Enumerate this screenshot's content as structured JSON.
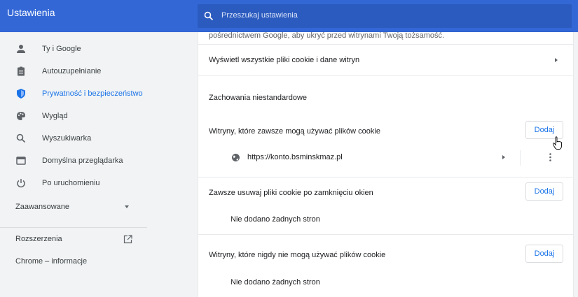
{
  "header": {
    "title": "Ustawienia",
    "search_placeholder": "Przeszukaj ustawienia"
  },
  "sidebar": {
    "items": [
      {
        "label": "Ty i Google",
        "icon": "person-icon",
        "active": false
      },
      {
        "label": "Autouzupełnianie",
        "icon": "clipboard-icon",
        "active": false
      },
      {
        "label": "Prywatność i bezpieczeństwo",
        "icon": "shield-icon",
        "active": true
      },
      {
        "label": "Wygląd",
        "icon": "palette-icon",
        "active": false
      },
      {
        "label": "Wyszukiwarka",
        "icon": "search-icon",
        "active": false
      },
      {
        "label": "Domyślna przeglądarka",
        "icon": "browser-icon",
        "active": false
      },
      {
        "label": "Po uruchomieniu",
        "icon": "power-icon",
        "active": false
      }
    ],
    "advanced_label": "Zaawansowane",
    "extensions_label": "Rozszerzenia",
    "about_label": "Chrome – informacje"
  },
  "content": {
    "truncated_text": "pośrednictwem Google, aby ukryć przed witrynami Twoją tożsamość.",
    "view_all_cookies": "Wyświetl wszystkie pliki cookie i dane witryn",
    "custom_behaviors_heading": "Zachowania niestandardowe",
    "sections": [
      {
        "label": "Witryny, które zawsze mogą używać plików cookie",
        "button": "Dodaj",
        "sites": [
          "https://konto.bsminskmaz.pl"
        ]
      },
      {
        "label": "Zawsze usuwaj pliki cookie po zamknięciu okien",
        "button": "Dodaj",
        "empty_text": "Nie dodano żadnych stron"
      },
      {
        "label": "Witryny, które nigdy nie mogą używać plików cookie",
        "button": "Dodaj",
        "empty_text": "Nie dodano żadnych stron"
      }
    ]
  },
  "colors": {
    "header_bg": "#3367d6",
    "accent": "#1a73e8",
    "sidebar_bg": "#f1f3f4"
  }
}
